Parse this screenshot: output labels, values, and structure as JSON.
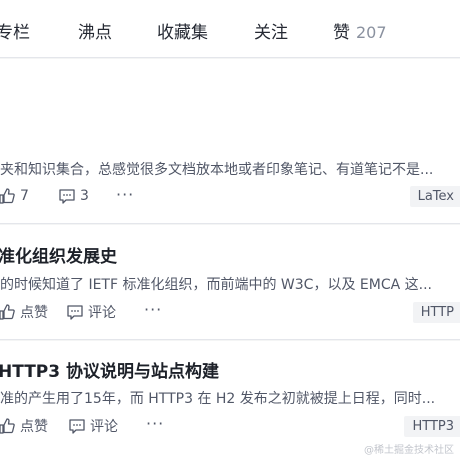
{
  "tabs": [
    {
      "label": "专栏"
    },
    {
      "label": "沸点"
    },
    {
      "label": "收藏集"
    },
    {
      "label": "关注"
    },
    {
      "label": "赞",
      "count": "207"
    }
  ],
  "articles": [
    {
      "title": "",
      "summary": "夹和知识集合，总感觉很多文档放本地或者印象笔记、有道笔记不是...",
      "like": "7",
      "comment": "3",
      "tag": "LaTex"
    },
    {
      "title": "准化组织发展史",
      "summary": "的时候知道了 IETF 标准化组织，而前端中的 W3C，以及 EMCA 这...",
      "like": "点赞",
      "comment": "评论",
      "tag": "HTTP"
    },
    {
      "title": "HTTP3 协议说明与站点构建",
      "summary": "准的产生用了15年，而 HTTP3 在 H2 发布之初就被提上日程，同时...",
      "like": "点赞",
      "comment": "评论",
      "tag": "HTTP3"
    }
  ],
  "more_glyph": "···",
  "watermark": "@稀土掘金技术社区"
}
